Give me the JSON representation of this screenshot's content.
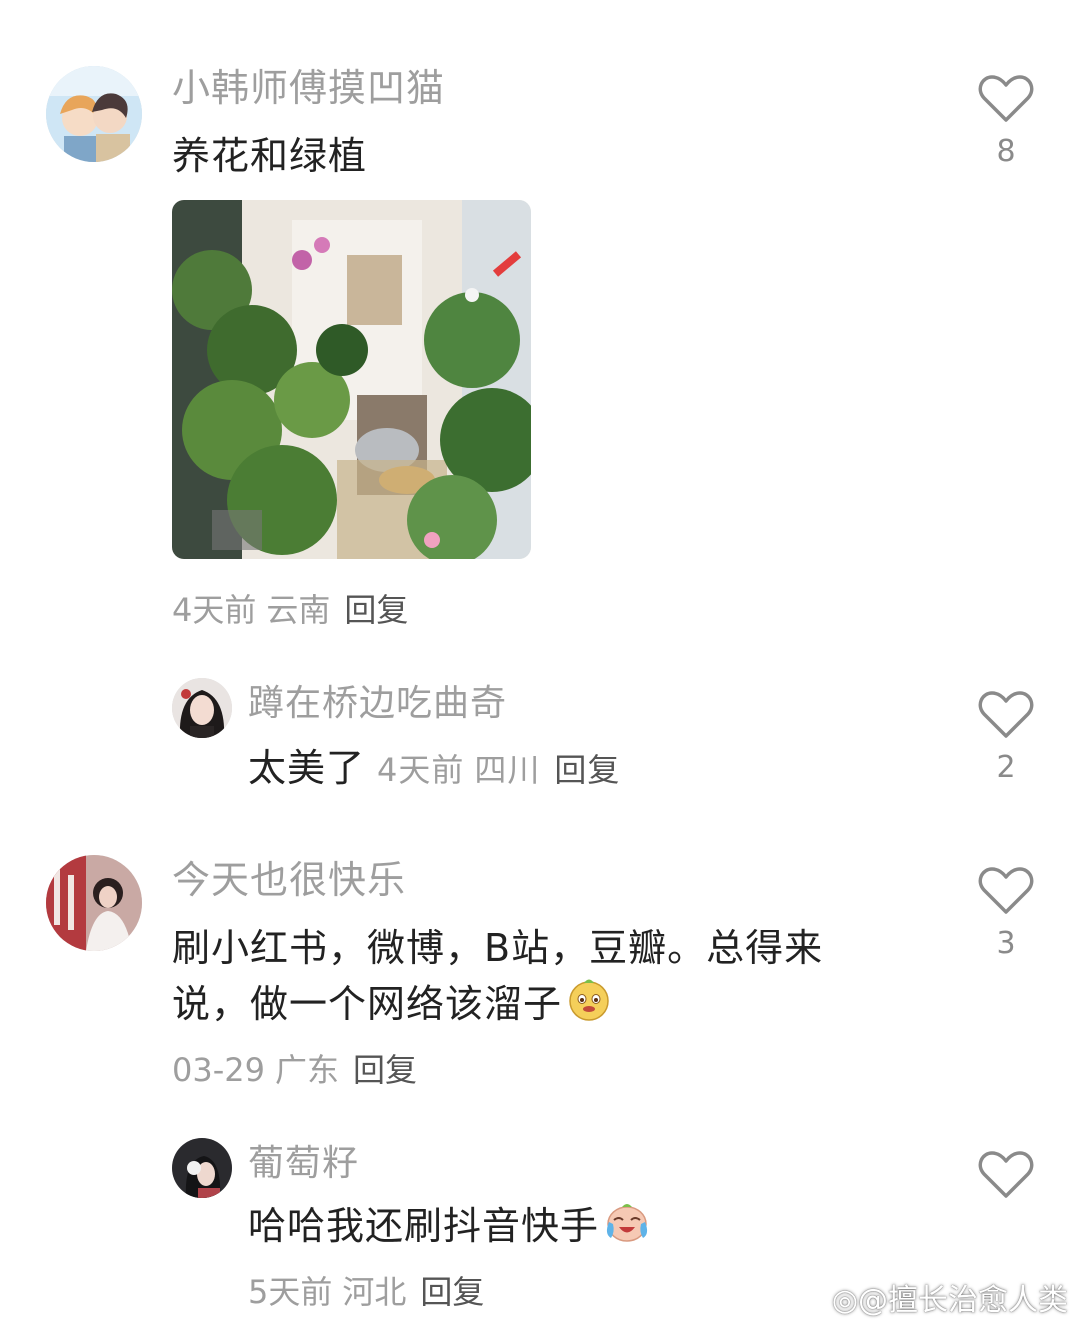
{
  "comments": [
    {
      "username": "小韩师傅摸凹猫",
      "text": "养花和绿植",
      "time": "4天前",
      "location": "云南",
      "reply_label": "回复",
      "likes": "8",
      "avatar_icon": "anime-boys-avatar",
      "image": "balcony-plants-photo"
    },
    {
      "username": "蹲在桥边吃曲奇",
      "text": "太美了",
      "time": "4天前",
      "location": "四川",
      "reply_label": "回复",
      "likes": "2",
      "is_reply": true,
      "avatar_icon": "girl-portrait-avatar"
    },
    {
      "username": "今天也很快乐",
      "text_line1": "刷小红书，微博，B站，豆瓣。总得来",
      "text_line2": "说，做一个网络该溜子",
      "emoji": "smirk-face-emoji",
      "time": "03-29",
      "location": "广东",
      "reply_label": "回复",
      "likes": "3",
      "avatar_icon": "girl-photo-avatar"
    },
    {
      "username": "葡萄籽",
      "text": "哈哈我还刷抖音快手",
      "emoji": "laugh-cry-emoji",
      "time": "5天前",
      "location": "河北",
      "reply_label": "回复",
      "likes": "",
      "is_reply": true,
      "avatar_icon": "girl-headphones-avatar"
    }
  ],
  "watermark": "@擅长治愈人类",
  "colors": {
    "username": "#9e9e9e",
    "text": "#222222",
    "meta": "#9e9e9e",
    "heart": "#8a8a8a"
  }
}
